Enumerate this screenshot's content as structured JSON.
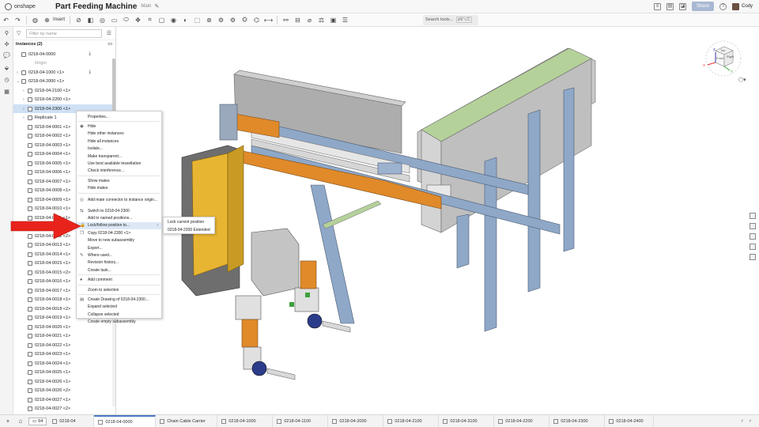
{
  "app": {
    "logo_text": "onshape",
    "title": "Part Feeding Machine",
    "workspace": "Main"
  },
  "topbar": {
    "share_label": "Share",
    "user_name": "Cody",
    "help_label": "?"
  },
  "toolbar": {
    "insert_label": "Insert",
    "search_placeholder": "Search tools...",
    "search_shortcut": "alt/⌥C"
  },
  "panel": {
    "filter_placeholder": "Filter by name",
    "instances_header": "Instances (2)",
    "tree": [
      {
        "label": "0218-04-0000",
        "indent": 0,
        "caret": "",
        "download": true
      },
      {
        "label": "Origin",
        "indent": 1,
        "caret": "",
        "muted": true
      },
      {
        "label": "0218-04-1000 <1>",
        "indent": 0,
        "caret": "›",
        "download": true
      },
      {
        "label": "0218-04-2000 <1>",
        "indent": 0,
        "caret": "⌄"
      },
      {
        "label": "0218-04-2100 <1>",
        "indent": 1,
        "caret": "›"
      },
      {
        "label": "0218-04-2200 <1>",
        "indent": 1,
        "caret": "›"
      },
      {
        "label": "0218-04-2300 <1>",
        "indent": 1,
        "caret": "›",
        "selected": true
      },
      {
        "label": "Replicate 1",
        "indent": 1,
        "caret": "›"
      },
      {
        "label": "0218-04-0001 <1>",
        "indent": 1,
        "caret": ""
      },
      {
        "label": "0218-04-0002 <1>",
        "indent": 1,
        "caret": ""
      },
      {
        "label": "0218-04-0003 <1>",
        "indent": 1,
        "caret": ""
      },
      {
        "label": "0218-04-0004 <1>",
        "indent": 1,
        "caret": ""
      },
      {
        "label": "0218-04-0005 <1>",
        "indent": 1,
        "caret": ""
      },
      {
        "label": "0218-04-0006 <1>",
        "indent": 1,
        "caret": ""
      },
      {
        "label": "0218-04-0007 <1>",
        "indent": 1,
        "caret": ""
      },
      {
        "label": "0218-04-0008 <1>",
        "indent": 1,
        "caret": ""
      },
      {
        "label": "0218-04-0009 <1>",
        "indent": 1,
        "caret": ""
      },
      {
        "label": "0218-04-0010 <1>",
        "indent": 1,
        "caret": ""
      },
      {
        "label": "0218-04-0011 <1>",
        "indent": 1,
        "caret": ""
      },
      {
        "label": "0218-04-0012 <1>",
        "indent": 1,
        "caret": ""
      },
      {
        "label": "0218-04-0012 <2>",
        "indent": 1,
        "caret": ""
      },
      {
        "label": "0218-04-0013 <1>",
        "indent": 1,
        "caret": ""
      },
      {
        "label": "0218-04-0014 <1>",
        "indent": 1,
        "caret": ""
      },
      {
        "label": "0218-04-0015 <1>",
        "indent": 1,
        "caret": ""
      },
      {
        "label": "0218-04-0015 <2>",
        "indent": 1,
        "caret": ""
      },
      {
        "label": "0218-04-0016 <1>",
        "indent": 1,
        "caret": ""
      },
      {
        "label": "0218-04-0017 <1>",
        "indent": 1,
        "caret": ""
      },
      {
        "label": "0218-04-0018 <1>",
        "indent": 1,
        "caret": ""
      },
      {
        "label": "0218-04-0018 <2>",
        "indent": 1,
        "caret": ""
      },
      {
        "label": "0218-04-0019 <1>",
        "indent": 1,
        "caret": ""
      },
      {
        "label": "0218-04-0020 <1>",
        "indent": 1,
        "caret": ""
      },
      {
        "label": "0218-04-0021 <1>",
        "indent": 1,
        "caret": ""
      },
      {
        "label": "0218-04-0022 <1>",
        "indent": 1,
        "caret": ""
      },
      {
        "label": "0218-04-0023 <1>",
        "indent": 1,
        "caret": ""
      },
      {
        "label": "0218-04-0024 <1>",
        "indent": 1,
        "caret": ""
      },
      {
        "label": "0218-04-0025 <1>",
        "indent": 1,
        "caret": ""
      },
      {
        "label": "0218-04-0026 <1>",
        "indent": 1,
        "caret": ""
      },
      {
        "label": "0218-04-0026 <2>",
        "indent": 1,
        "caret": ""
      },
      {
        "label": "0218-04-0027 <1>",
        "indent": 1,
        "caret": ""
      },
      {
        "label": "0218-04-0027 <2>",
        "indent": 1,
        "caret": ""
      }
    ]
  },
  "context_menu": {
    "items": [
      {
        "label": "Properties...",
        "icon": "",
        "sep_after": true
      },
      {
        "label": "Hide",
        "icon": "◉"
      },
      {
        "label": "Hide other instances",
        "icon": ""
      },
      {
        "label": "Hide all instances",
        "icon": ""
      },
      {
        "label": "Isolate...",
        "icon": ""
      },
      {
        "label": "Make transparent...",
        "icon": ""
      },
      {
        "label": "Use best available tessellation",
        "icon": ""
      },
      {
        "label": "Check interference...",
        "icon": "",
        "sep_after": true
      },
      {
        "label": "Show mates",
        "icon": ""
      },
      {
        "label": "Hide mates",
        "icon": "",
        "sep_after": true
      },
      {
        "label": "Add mate connector to instance origin...",
        "icon": "◎",
        "tall": true
      },
      {
        "label": "Switch to 0218-04-2300",
        "icon": "⇆"
      },
      {
        "label": "Add to named positions...",
        "icon": ""
      },
      {
        "label": "Lock/follow position to...",
        "icon": "🔒",
        "highlight": true,
        "submenu": true
      },
      {
        "label": "Copy 0218-04-2300 <1>",
        "icon": "❐"
      },
      {
        "label": "Move to new subassembly",
        "icon": ""
      },
      {
        "label": "Export...",
        "icon": ""
      },
      {
        "label": "Where used...",
        "icon": "✎"
      },
      {
        "label": "Revision history...",
        "icon": ""
      },
      {
        "label": "Create task...",
        "icon": "",
        "sep_after": true
      },
      {
        "label": "Add comment",
        "icon": "●",
        "sep_after": true
      },
      {
        "label": "Zoom to selection",
        "icon": "",
        "sep_after": true
      },
      {
        "label": "Create Drawing of 0218-04-2300...",
        "icon": "▤"
      },
      {
        "label": "Expand selected",
        "icon": ""
      },
      {
        "label": "Collapse selected",
        "icon": ""
      },
      {
        "label": "Create empty subassembly",
        "icon": ""
      }
    ]
  },
  "submenu": {
    "items": [
      "Lock current position",
      "0218-04-2300 Extended"
    ]
  },
  "viewcube": {
    "top": "Top",
    "front": "Front",
    "right": "Right",
    "axes": [
      "X",
      "Y",
      "Z"
    ]
  },
  "bottom": {
    "tab_count": "64",
    "tabs": [
      {
        "label": "0218-04"
      },
      {
        "label": "0218-04-0000",
        "active": true
      },
      {
        "label": "Chain Cable Carrier"
      },
      {
        "label": "0218-04-1000"
      },
      {
        "label": "0218-04-1100"
      },
      {
        "label": "0218-04-2000"
      },
      {
        "label": "0218-04-2100"
      },
      {
        "label": "0218-04-3100"
      },
      {
        "label": "0218-04-2200"
      },
      {
        "label": "0218-04-2300"
      },
      {
        "label": "0218-04-2400"
      }
    ]
  },
  "colors": {
    "accent": "#4a78c2",
    "selection": "#cfe0f5",
    "arrow": "#e8231b",
    "steel_blue": "#8fa8c8",
    "orange": "#e08a2a",
    "yellow": "#e8b532"
  }
}
